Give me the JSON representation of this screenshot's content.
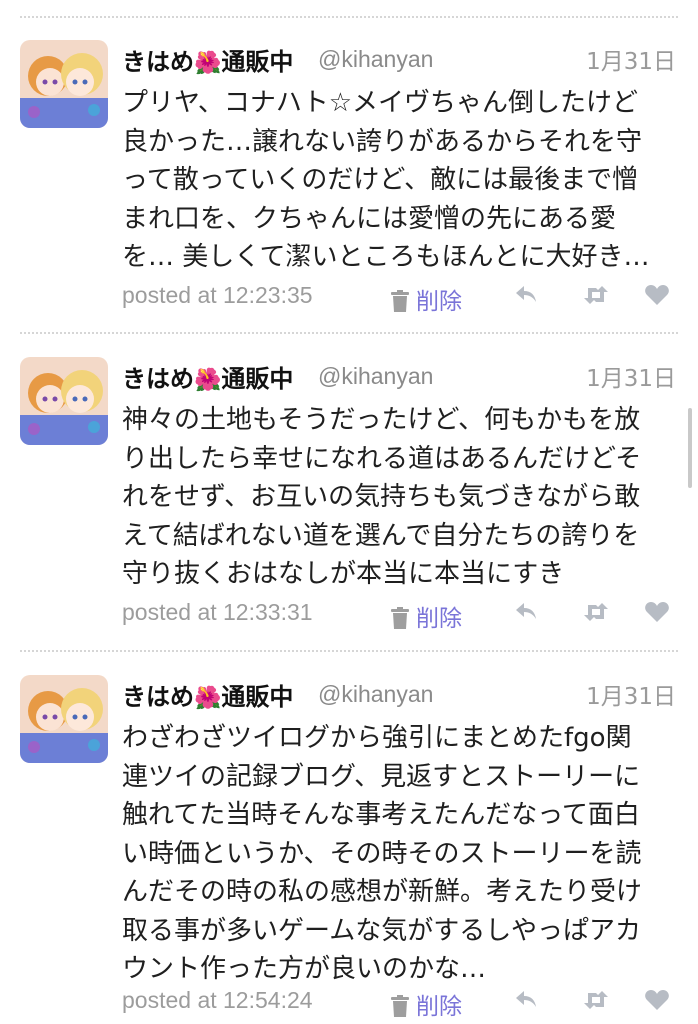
{
  "tweets": [
    {
      "user_name": "きはめ",
      "user_name_suffix": "通販中",
      "flower": "🌺",
      "handle": "@kihanyan",
      "date": "1月31日",
      "lines": [
        "プリヤ、コナハト☆メイヴちゃん倒したけど",
        "良かった…譲れない誇りがあるからそれを守",
        "って散っていくのだけど、敵には最後まで憎",
        "まれ口を、クちゃんには愛憎の先にある愛",
        "を… 美しくて潔いところもほんとに大好き…"
      ],
      "posted": "posted at 12:23:35",
      "delete_label": "削除"
    },
    {
      "user_name": "きはめ",
      "user_name_suffix": "通販中",
      "flower": "🌺",
      "handle": "@kihanyan",
      "date": "1月31日",
      "lines": [
        "神々の土地もそうだったけど、何もかもを放",
        "り出したら幸せになれる道はあるんだけどそ",
        "れをせず、お互いの気持ちも気づきながら敢",
        "えて結ばれない道を選んで自分たちの誇りを",
        "守り抜くおはなしが本当に本当にすき"
      ],
      "posted": "posted at 12:33:31",
      "delete_label": "削除"
    },
    {
      "user_name": "きはめ",
      "user_name_suffix": "通販中",
      "flower": "🌺",
      "handle": "@kihanyan",
      "date": "1月31日",
      "lines": [
        "わざわざツイログから強引にまとめたfgo関",
        "連ツイの記録ブログ、見返すとストーリーに",
        "触れてた当時そんな事考えたんだなって面白",
        "い時価というか、その時そのストーリーを読",
        "んだその時の私の感想が新鮮。考えたり受け",
        "取る事が多いゲームな気がするしやっぱアカ",
        "ウント作った方が良いのかな…"
      ],
      "posted": "posted at 12:54:24",
      "delete_label": "削除"
    }
  ],
  "icons": [
    "trash-icon",
    "reply-icon",
    "retweet-icon",
    "like-icon"
  ],
  "colors": {
    "delete": "#7a74d8",
    "meta": "#9c9c9c",
    "icons": "#b7bcc4"
  }
}
